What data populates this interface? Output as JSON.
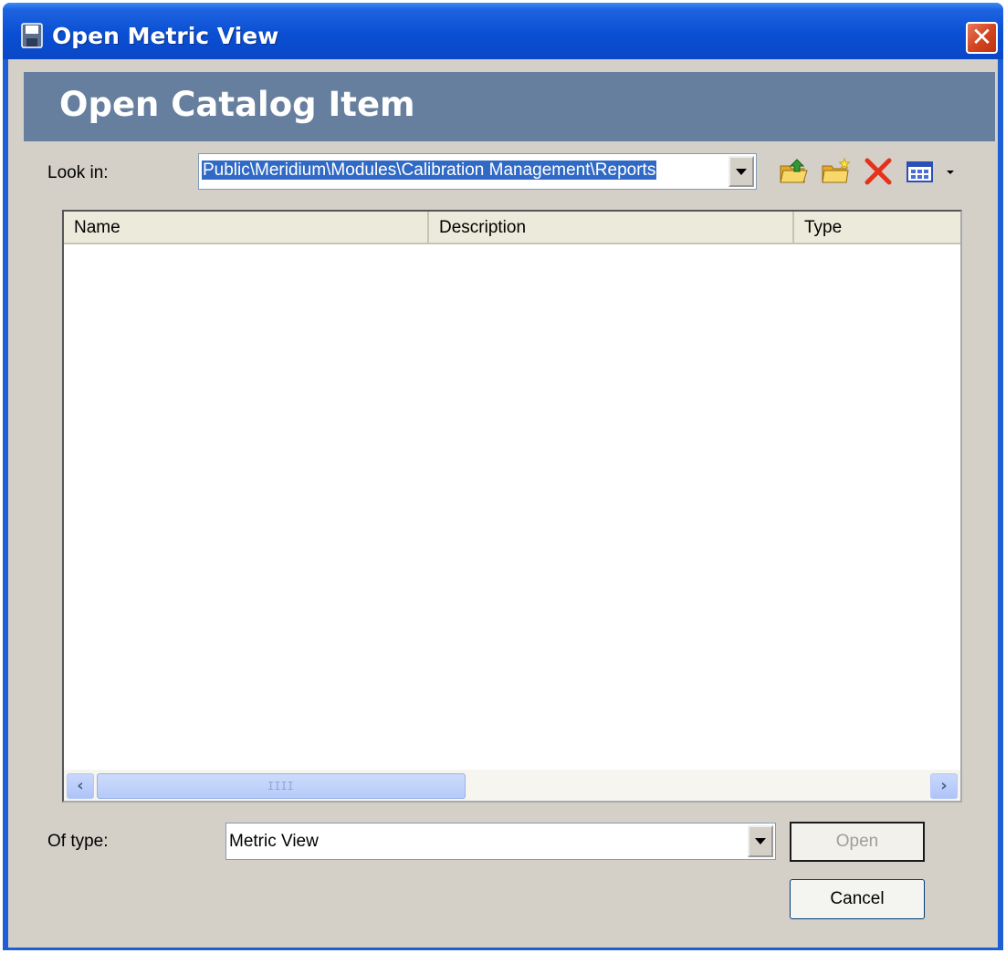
{
  "window": {
    "title": "Open Metric View",
    "close_glyph": "✕"
  },
  "header": {
    "title": "Open Catalog Item"
  },
  "look_in": {
    "label": "Look in:",
    "value": "Public\\Meridium\\Modules\\Calibration Management\\Reports"
  },
  "toolbar": {
    "icons": [
      "up-folder-icon",
      "new-folder-icon",
      "delete-icon",
      "view-menu-icon",
      "dropdown-arrow-icon"
    ],
    "delete_color": "#e5321b"
  },
  "list": {
    "columns": [
      "Name",
      "Description",
      "Type"
    ],
    "rows": []
  },
  "of_type": {
    "label": "Of type:",
    "value": "Metric View"
  },
  "buttons": {
    "open": "Open",
    "cancel": "Cancel"
  },
  "scrollbar": {
    "left_glyph": "‹",
    "right_glyph": "›",
    "grip": "IIII"
  },
  "colors": {
    "title_bar": "#0a4fd3",
    "header_band": "#677f9e",
    "dialog_bg": "#d4d0c8",
    "selection": "#316ac5"
  }
}
